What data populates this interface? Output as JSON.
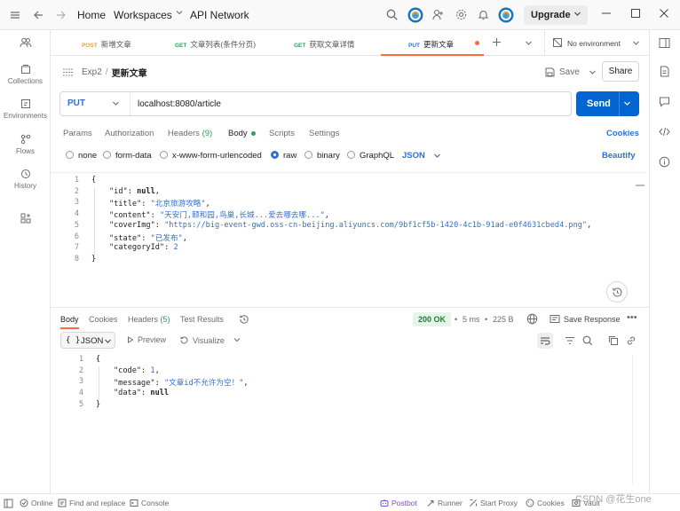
{
  "topbar": {
    "home_label": "Home",
    "workspaces_label": "Workspaces",
    "api_network_label": "API Network",
    "upgrade_label": "Upgrade"
  },
  "sidebar": {
    "items": [
      {
        "label": "",
        "icon": "user-group-icon"
      },
      {
        "label": "Collections",
        "icon": "collections-icon"
      },
      {
        "label": "Environments",
        "icon": "environments-icon"
      },
      {
        "label": "Flows",
        "icon": "flows-icon"
      },
      {
        "label": "History",
        "icon": "history-icon"
      },
      {
        "label": "",
        "icon": "add-apps-icon"
      }
    ]
  },
  "tabs": [
    {
      "method": "POST",
      "title": "新增文章",
      "active": false
    },
    {
      "method": "GET",
      "title": "文章列表(条件分页)",
      "active": false
    },
    {
      "method": "GET",
      "title": "获取文章详情",
      "active": false
    },
    {
      "method": "PUT",
      "title": "更新文章",
      "active": true
    }
  ],
  "environment": {
    "label": "No environment"
  },
  "request": {
    "breadcrumb_parent": "Exp2",
    "breadcrumb_separator": "/",
    "name": "更新文章",
    "save_label": "Save",
    "share_label": "Share",
    "method": "PUT",
    "url": "localhost:8080/article",
    "send_label": "Send",
    "subtabs": {
      "params": "Params",
      "authorization": "Authorization",
      "headers": "Headers",
      "headers_count": "(9)",
      "body": "Body",
      "scripts": "Scripts",
      "settings": "Settings",
      "cookies": "Cookies"
    },
    "body_types": {
      "none": "none",
      "form_data": "form-data",
      "urlencoded": "x-www-form-urlencoded",
      "raw": "raw",
      "binary": "binary",
      "graphql": "GraphQL",
      "selected": "raw"
    },
    "format": "JSON",
    "beautify_label": "Beautify",
    "body_lines": [
      {
        "n": "1",
        "text": "{"
      },
      {
        "n": "2",
        "key": "\"id\"",
        "value": "null",
        "vtype": "null",
        "comma": ","
      },
      {
        "n": "3",
        "key": "\"title\"",
        "value": "\"北京旅游攻略\"",
        "vtype": "string",
        "comma": ","
      },
      {
        "n": "4",
        "key": "\"content\"",
        "value": "\"天安门,颐和园,鸟巢,长城...爱去哪去哪...\"",
        "vtype": "string",
        "comma": ","
      },
      {
        "n": "5",
        "key": "\"coverImg\"",
        "value": "\"https://big-event-gwd.oss-cn-beijing.aliyuncs.com/9bf1cf5b-1420-4c1b-91ad-e0f4631cbed4.png\"",
        "vtype": "string",
        "comma": ","
      },
      {
        "n": "6",
        "key": "\"state\"",
        "value": "\"已发布\"",
        "vtype": "string",
        "comma": ","
      },
      {
        "n": "7",
        "key": "\"categoryId\"",
        "value": "2",
        "vtype": "number",
        "comma": ""
      },
      {
        "n": "8",
        "text": "}"
      }
    ]
  },
  "response": {
    "tabs": {
      "body": "Body",
      "cookies": "Cookies",
      "headers": "Headers",
      "headers_count": "(5)",
      "test_results": "Test Results"
    },
    "status": "200 OK",
    "time": "5 ms",
    "size": "225 B",
    "save_response_label": "Save Response",
    "format": "JSON",
    "preview_label": "Preview",
    "visualize_label": "Visualize",
    "body_lines": [
      {
        "n": "1",
        "text": "{"
      },
      {
        "n": "2",
        "key": "\"code\"",
        "value": "1",
        "vtype": "number",
        "comma": ","
      },
      {
        "n": "3",
        "key": "\"message\"",
        "value": "\"文章id不允许为空！\"",
        "vtype": "string",
        "comma": ","
      },
      {
        "n": "4",
        "key": "\"data\"",
        "value": "null",
        "vtype": "null",
        "comma": ""
      },
      {
        "n": "5",
        "text": "}"
      }
    ]
  },
  "statusbar": {
    "online": "Online",
    "find_replace": "Find and replace",
    "console": "Console",
    "postbot": "Postbot",
    "runner": "Runner",
    "start_proxy": "Start Proxy",
    "cookies": "Cookies",
    "vault": "Vault"
  },
  "watermark": "CSDN @花生one",
  "colors": {
    "accent": "#ff6c37",
    "send_blue": "#0265d2",
    "link_blue": "#2f6fd6",
    "status_green": "#1e7d3a",
    "postbot_purple": "#7b4fd8"
  }
}
